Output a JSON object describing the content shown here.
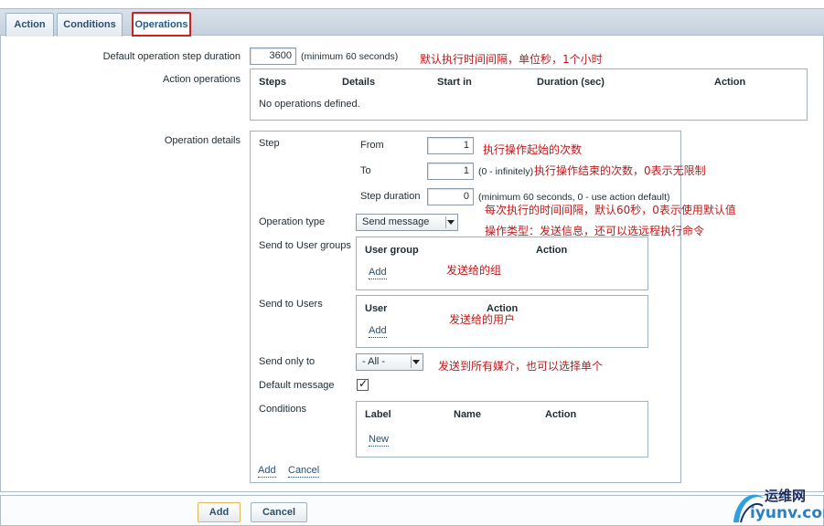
{
  "tabs": [
    {
      "label": "Action"
    },
    {
      "label": "Conditions"
    },
    {
      "label": "Operations",
      "active": true
    }
  ],
  "form": {
    "default_duration": {
      "label": "Default operation step duration",
      "value": "3600",
      "hint": "(minimum 60 seconds)",
      "note": "默认执行时间间隔，单位秒，1个小时"
    },
    "action_operations": {
      "label": "Action operations",
      "columns": [
        "Steps",
        "Details",
        "Start in",
        "Duration (sec)",
        "Action"
      ],
      "empty_text": "No operations defined."
    },
    "operation_details": {
      "label": "Operation details",
      "step": {
        "label": "Step",
        "from_label": "From",
        "from_value": "1",
        "from_note": "执行操作起始的次数",
        "to_label": "To",
        "to_value": "1",
        "to_hint": "(0 - infinitely)",
        "to_note": "执行操作结束的次数，0表示无限制",
        "duration_label": "Step duration",
        "duration_value": "0",
        "duration_hint": "(minimum 60 seconds, 0 - use action default)",
        "duration_note": "每次执行的时间间隔，默认60秒，0表示使用默认值"
      },
      "operation_type": {
        "label": "Operation type",
        "selected": "Send message",
        "note": "操作类型：发送信息，还可以选远程执行命令"
      },
      "user_groups": {
        "label": "Send to User groups",
        "columns": [
          "User group",
          "Action"
        ],
        "add_label": "Add",
        "note": "发送给的组"
      },
      "users": {
        "label": "Send to Users",
        "columns": [
          "User",
          "Action"
        ],
        "add_label": "Add",
        "note": "发送给的用户"
      },
      "send_only_to": {
        "label": "Send only to",
        "selected": "- All -",
        "note": "发送到所有媒介，也可以选择单个"
      },
      "default_message": {
        "label": "Default message",
        "checked": true,
        "tick": "✓"
      },
      "conditions": {
        "label": "Conditions",
        "columns": [
          "Label",
          "Name",
          "Action"
        ],
        "new_label": "New"
      },
      "add_link": "Add",
      "cancel_link": "Cancel"
    }
  },
  "footer": {
    "add_button": "Add",
    "cancel_button": "Cancel"
  },
  "logo": {
    "chinese": "运维网",
    "domain": "iyunv.com"
  },
  "colors": {
    "annotation": "#c0181a",
    "link": "#2b4f71",
    "highlight_border": "#cc1f1f"
  }
}
